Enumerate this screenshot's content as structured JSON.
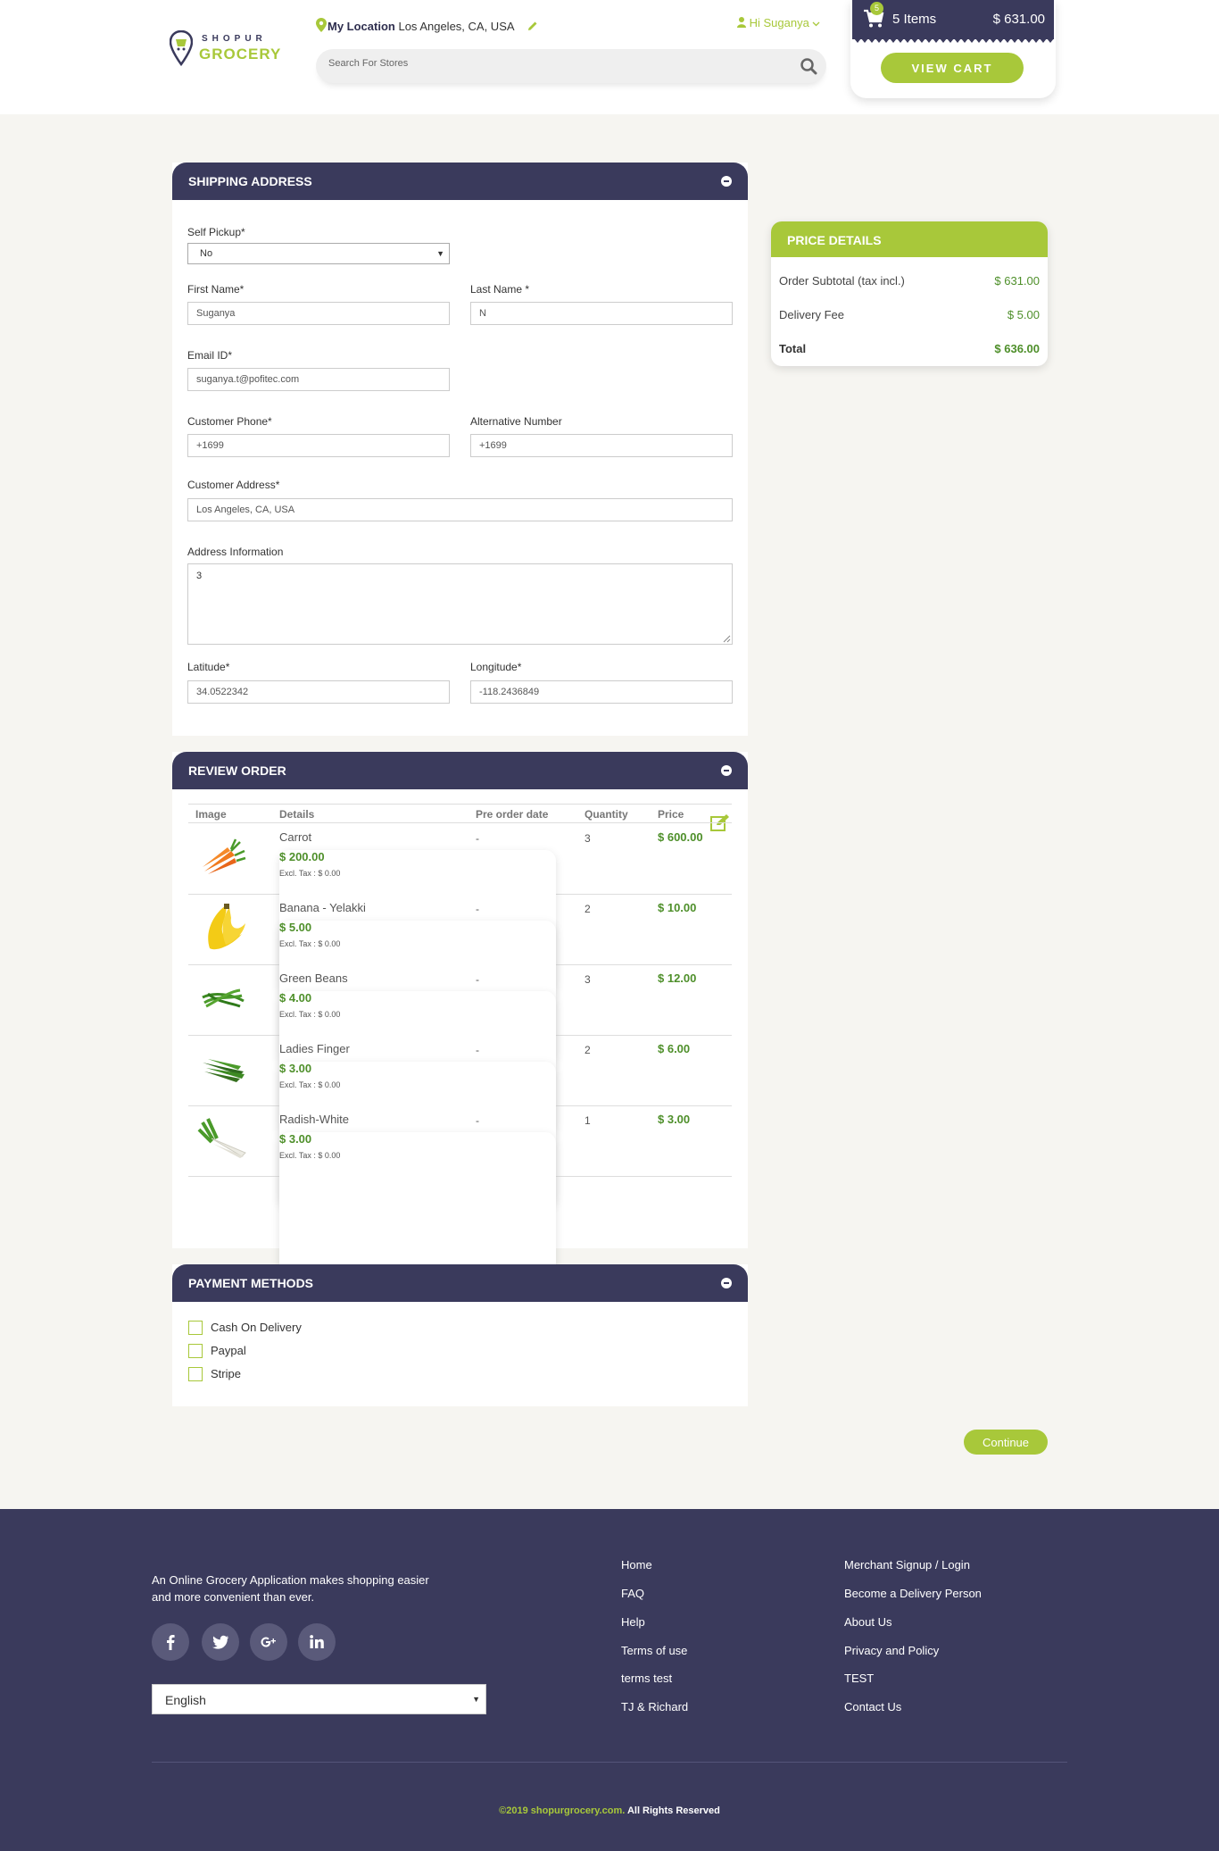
{
  "header": {
    "logo_top": "SHOPUR",
    "logo_bottom": "GROCERY",
    "location_label": "My Location",
    "location_value": "Los Angeles, CA, USA",
    "search_placeholder": "Search For Stores",
    "user_greeting": "Hi Suganya",
    "cart": {
      "badge": "5",
      "items": "5 Items",
      "total": "$ 631.00",
      "view_cart": "VIEW CART"
    }
  },
  "shipping": {
    "title": "SHIPPING ADDRESS",
    "self_pickup_label": "Self Pickup*",
    "self_pickup_value": "No",
    "first_name_label": "First Name*",
    "first_name_value": "Suganya",
    "last_name_label": "Last Name *",
    "last_name_value": "N",
    "email_label": "Email ID*",
    "email_value": "suganya.t@pofitec.com",
    "phone_label": "Customer Phone*",
    "phone_value": "+1699",
    "alt_label": "Alternative Number",
    "alt_value": "+1699",
    "address_label": "Customer Address*",
    "address_value": "Los Angeles, CA, USA",
    "info_label": "Address Information",
    "info_value": "3",
    "lat_label": "Latitude*",
    "lat_value": "34.0522342",
    "lng_label": "Longitude*",
    "lng_value": "-118.2436849"
  },
  "review": {
    "title": "REVIEW ORDER",
    "columns": [
      "Image",
      "Details",
      "Pre order date",
      "Quantity",
      "Price"
    ],
    "items": [
      {
        "name": "Carrot",
        "price": "$ 200.00",
        "tax": "Excl. Tax : $ 0.00",
        "pre": "-",
        "qty": "3",
        "total": "$ 600.00"
      },
      {
        "name": "Banana - Yelakki",
        "price": "$ 5.00",
        "tax": "Excl. Tax : $ 0.00",
        "pre": "-",
        "qty": "2",
        "total": "$ 10.00"
      },
      {
        "name": "Green Beans",
        "price": "$ 4.00",
        "tax": "Excl. Tax : $ 0.00",
        "pre": "-",
        "qty": "3",
        "total": "$ 12.00"
      },
      {
        "name": "Ladies Finger",
        "price": "$ 3.00",
        "tax": "Excl. Tax : $ 0.00",
        "pre": "-",
        "qty": "2",
        "total": "$ 6.00"
      },
      {
        "name": "Radish-White",
        "price": "$ 3.00",
        "tax": "Excl. Tax : $ 0.00",
        "pre": "-",
        "qty": "1",
        "total": "$ 3.00"
      }
    ]
  },
  "payment": {
    "title": "PAYMENT METHODS",
    "methods": [
      "Cash On Delivery",
      "Paypal",
      "Stripe"
    ]
  },
  "price_details": {
    "title": "PRICE DETAILS",
    "subtotal_label": "Order Subtotal (tax incl.)",
    "subtotal_value": "$ 631.00",
    "delivery_label": "Delivery Fee",
    "delivery_value": "$ 5.00",
    "total_label": "Total",
    "total_value": "$ 636.00"
  },
  "continue_label": "Continue",
  "footer": {
    "description": "An Online Grocery Application makes shopping easier and more convenient than ever.",
    "language": "English",
    "links_col1": [
      "Home",
      "FAQ",
      "Help",
      "Terms of use",
      "terms test",
      "TJ & Richard"
    ],
    "links_col2": [
      "Merchant Signup / Login",
      "Become a Delivery Person",
      "About Us",
      "Privacy and Policy",
      "TEST",
      "Contact Us"
    ],
    "copyright_green": "©2019 shopurgrocery.com.",
    "copyright_rest": " All Rights Reserved"
  },
  "colors": {
    "navy": "#3a3a5c",
    "green": "#a8c83a",
    "price_green": "#4e8f2a",
    "background": "#f6f5f1"
  }
}
